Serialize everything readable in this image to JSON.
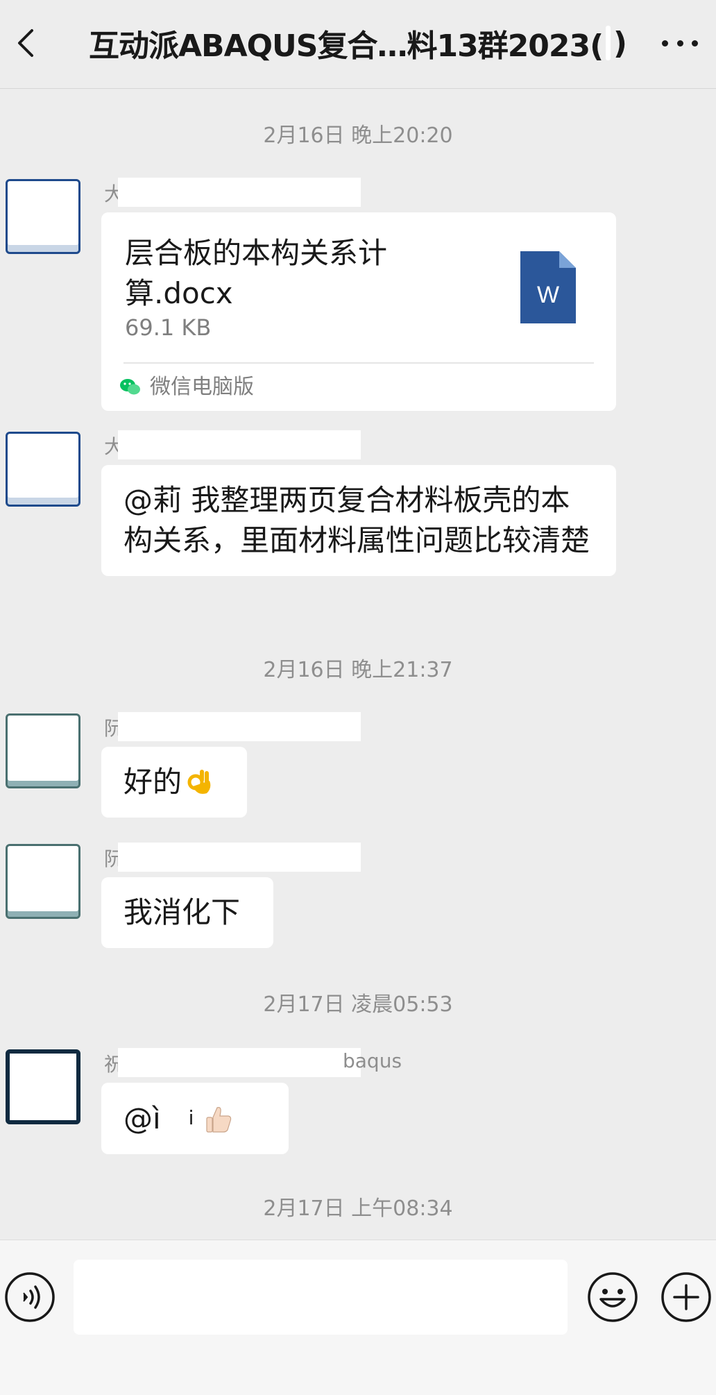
{
  "header": {
    "title": "互动派ABAQUS复合…料13群2023(",
    "title_close": ")"
  },
  "timestamps": [
    "2月16日 晚上20:20",
    "2月16日 晚上21:37",
    "2月17日 凌晨05:53",
    "2月17日 上午08:34"
  ],
  "messages": [
    {
      "sender_char": "大",
      "file": {
        "name": "层合板的本构关系计算.docx",
        "size": "69.1 KB",
        "icon_letter": "W",
        "source": "微信电脑版"
      }
    },
    {
      "sender_char": "大",
      "text": "@莉  我整理两页复合材料板壳的本构关系，里面材料属性问题比较清楚"
    },
    {
      "sender_char": "阮",
      "text": "好的"
    },
    {
      "sender_char": "阮",
      "text": "我消化下"
    },
    {
      "sender_char": "祝",
      "sender_tail": "baqus",
      "text": "@ì",
      "text_fragment": "ⅰ"
    }
  ],
  "input_bar": {
    "input_value": ""
  },
  "icons": {
    "back": "chevron-left-icon",
    "more": "more-dots-icon",
    "voice": "voice-icon",
    "emoji": "emoji-icon",
    "plus": "plus-icon",
    "word": "word-file-icon",
    "wechat": "wechat-icon",
    "ok_hand": "ok-hand-emoji",
    "thumbs_up": "thumbs-up-emoji"
  },
  "colors": {
    "background": "#ededed",
    "bubble": "#ffffff",
    "word_blue": "#2b579a",
    "wechat_green": "#07c160",
    "timestamp": "#8e8e8e"
  }
}
